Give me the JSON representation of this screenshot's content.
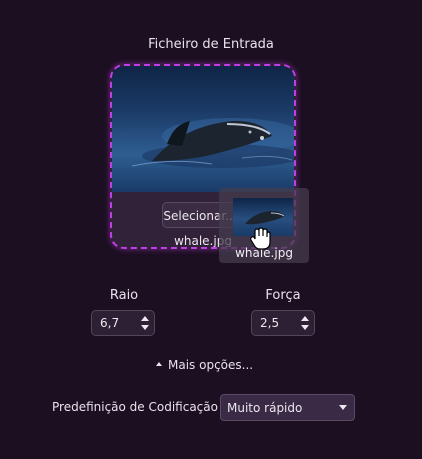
{
  "input": {
    "title": "Ficheiro de Entrada",
    "select_button": "Selecionar...",
    "file_name": "whale.jpg"
  },
  "drag": {
    "label": "whale.jpg"
  },
  "raio": {
    "label": "Raio",
    "value": "6,7"
  },
  "forca": {
    "label": "Força",
    "value": "2,5"
  },
  "more_options": {
    "label": "Mais opções..."
  },
  "preset": {
    "label": "Predefinição de Codificação",
    "value": "Muito rápido"
  },
  "colors": {
    "background": "#1d0f22",
    "accent": "#c13ee6"
  }
}
